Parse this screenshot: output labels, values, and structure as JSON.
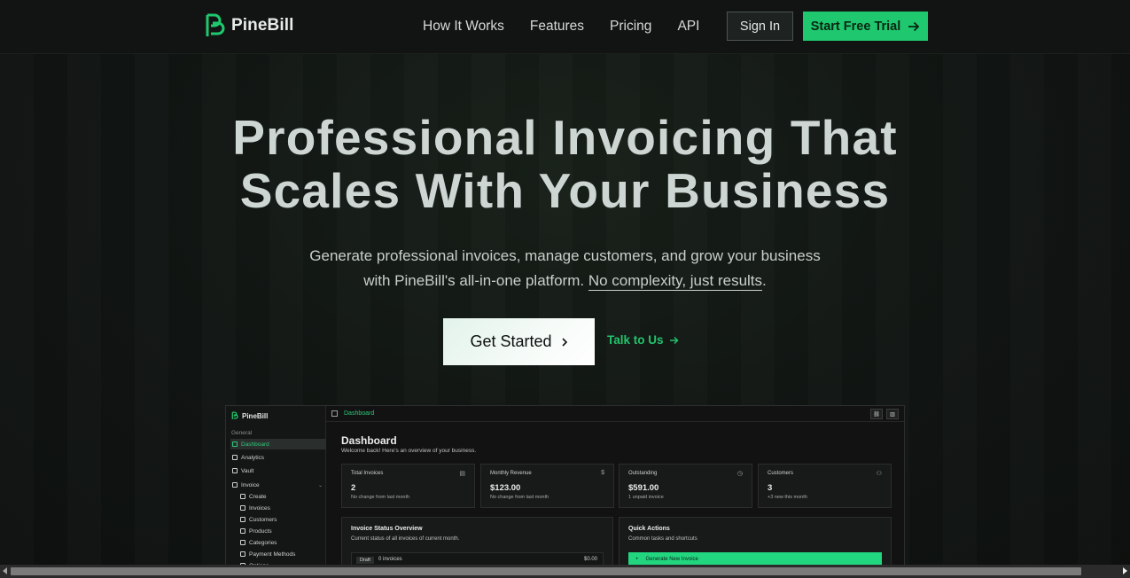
{
  "brand": {
    "name": "PineBill",
    "accent": "#1fc86e"
  },
  "nav": {
    "links": [
      "How It Works",
      "Features",
      "Pricing",
      "API"
    ],
    "signin_label": "Sign In",
    "trial_label": "Start Free Trial"
  },
  "hero": {
    "title_line1": "Professional Invoicing That",
    "title_line2": "Scales With Your Business",
    "subtitle_part1": "Generate professional invoices, manage customers, and grow your business",
    "subtitle_part2": "with PineBill's all-in-one platform.",
    "subtitle_highlight": "No complexity, just results",
    "subtitle_end": ".",
    "cta_primary": "Get Started",
    "cta_secondary": "Talk to Us"
  },
  "preview": {
    "brand": "PineBill",
    "breadcrumb": "Dashboard",
    "sidebar": {
      "group_label": "General",
      "items": [
        "Dashboard",
        "Analytics",
        "Vault",
        "Invoice"
      ],
      "sub_items": [
        "Create",
        "Invoices",
        "Customers",
        "Products",
        "Categories",
        "Payment Methods",
        "Options"
      ]
    },
    "title": "Dashboard",
    "welcome": "Welcome back! Here's an overview of your business.",
    "cards": [
      {
        "title": "Total Invoices",
        "value": "2",
        "note": "No change from last month",
        "icon": "document-icon"
      },
      {
        "title": "Monthly Revenue",
        "value": "$123.00",
        "note": "No change from last month",
        "icon": "dollar-icon"
      },
      {
        "title": "Outstanding",
        "value": "$591.00",
        "note": "1 unpaid invoice",
        "icon": "clock-icon"
      },
      {
        "title": "Customers",
        "value": "3",
        "note": "+3 new this month",
        "icon": "users-icon"
      }
    ],
    "status_box": {
      "title": "Invoice Status Overview",
      "subtitle": "Current status of all invoices of current month.",
      "row_badge": "Draft",
      "row_count": "0 invoices",
      "row_amount": "$0.00"
    },
    "quick_box": {
      "title": "Quick Actions",
      "subtitle": "Common tasks and shortcuts",
      "action": "Generate New Invoice"
    }
  }
}
